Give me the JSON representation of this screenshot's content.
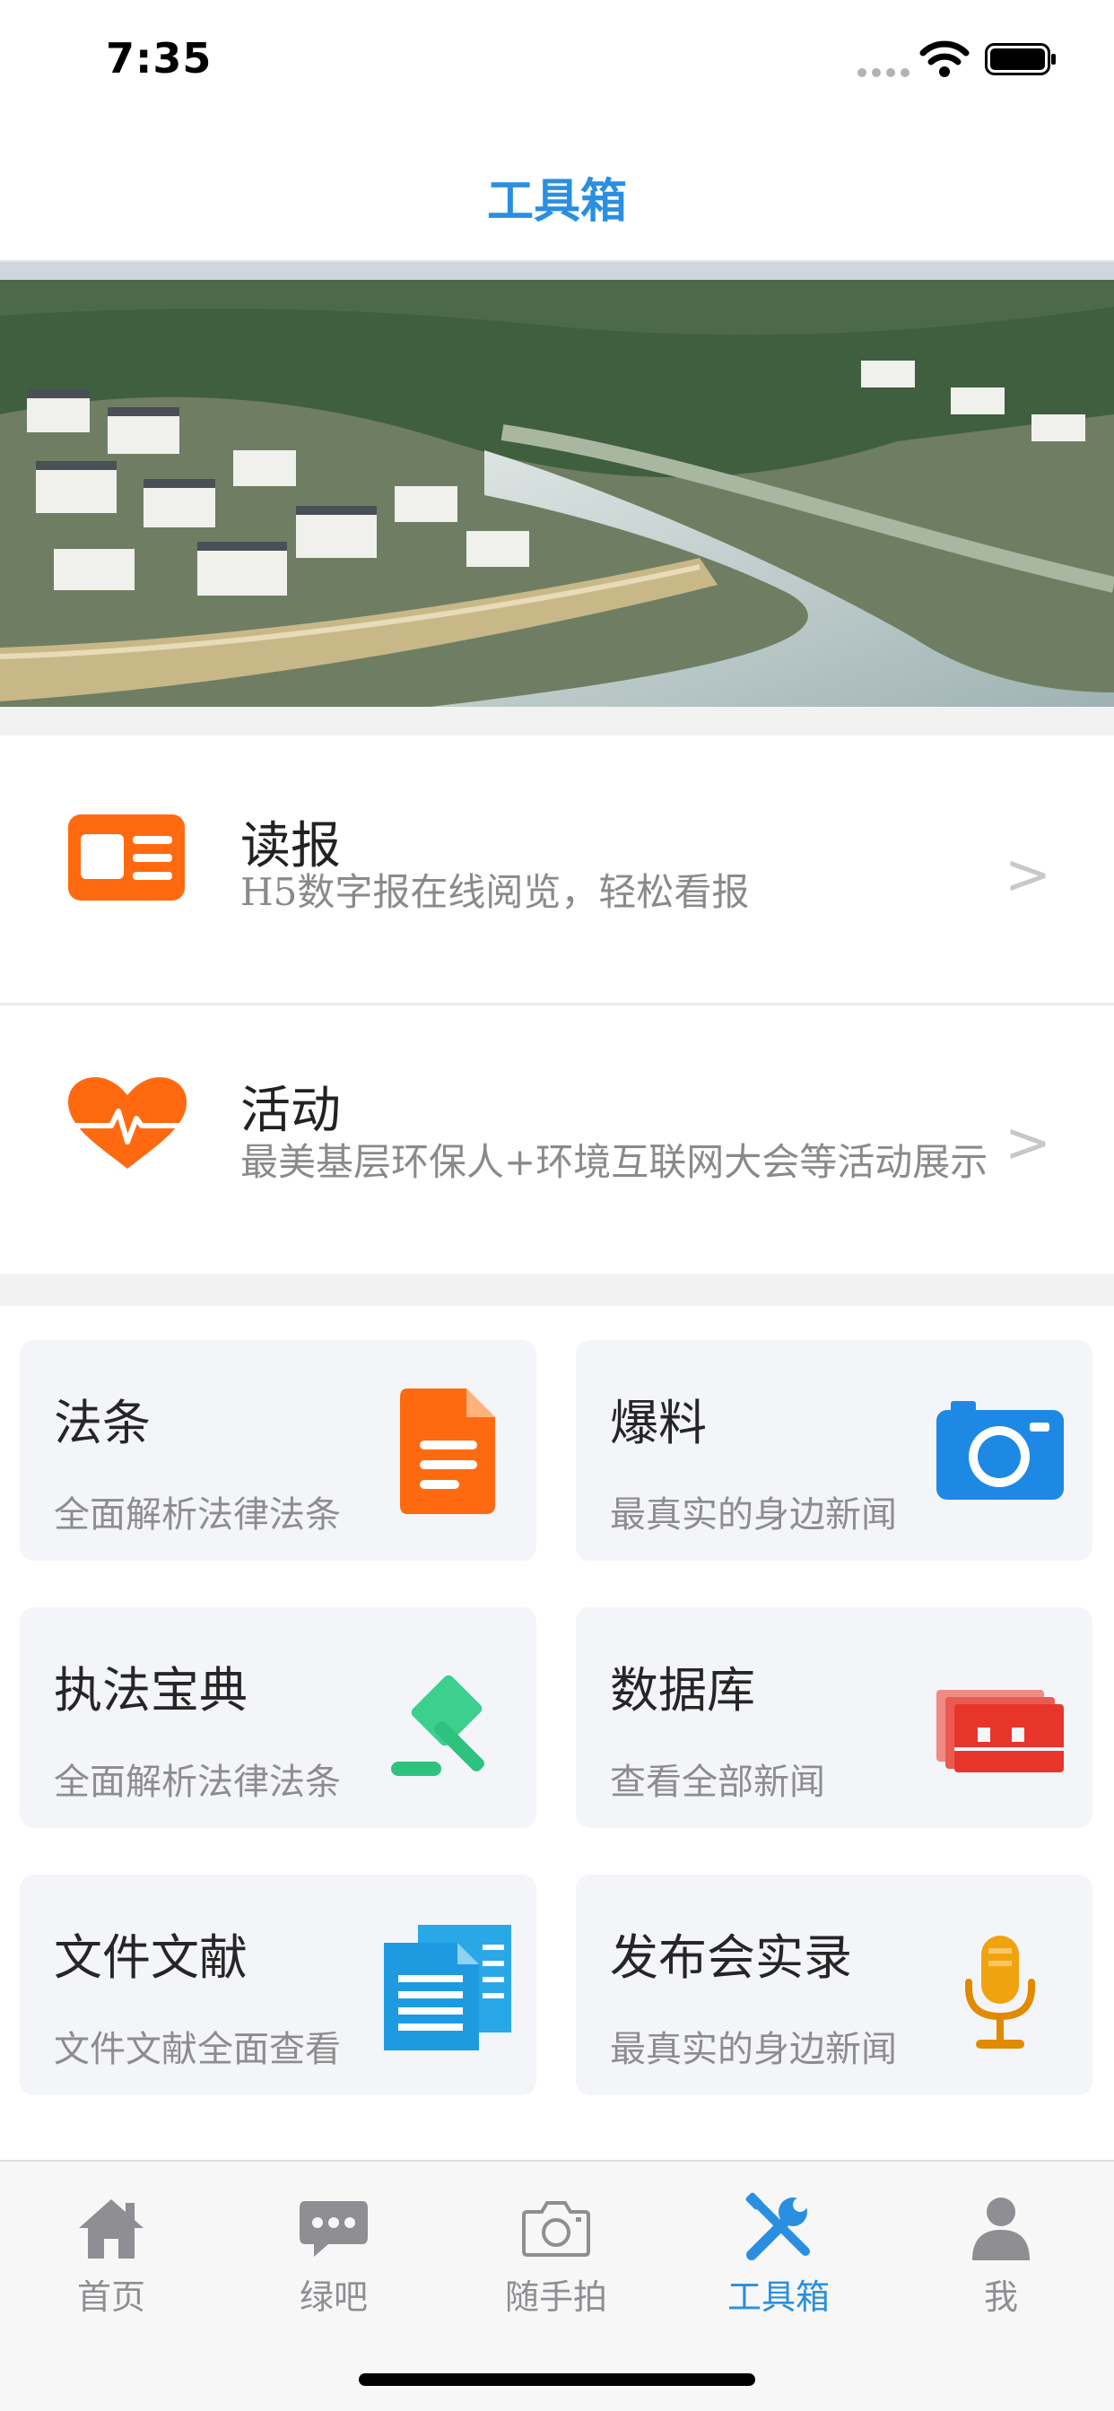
{
  "status": {
    "time": "7:35"
  },
  "nav": {
    "title": "工具箱"
  },
  "banner": {
    "slides": 4,
    "active_slide": 1
  },
  "list": [
    {
      "title": "读报",
      "subtitle": "H5数字报在线阅览，轻松看报",
      "arrow": ">",
      "icon": "newspaper-icon"
    },
    {
      "title": "活动",
      "subtitle": "最美基层环保人+环境互联网大会等活动展示",
      "arrow": ">",
      "icon": "heartbeat-icon"
    }
  ],
  "grid": [
    {
      "title": "法条",
      "subtitle": "全面解析法律法条",
      "icon": "document-icon"
    },
    {
      "title": "爆料",
      "subtitle": "最真实的身边新闻",
      "icon": "camera-icon"
    },
    {
      "title": "执法宝典",
      "subtitle": "全面解析法律法条",
      "icon": "gavel-icon"
    },
    {
      "title": "数据库",
      "subtitle": "查看全部新闻",
      "icon": "database-icon"
    },
    {
      "title": "文件文献",
      "subtitle": "文件文献全面查看",
      "icon": "files-icon"
    },
    {
      "title": "发布会实录",
      "subtitle": "最真实的身边新闻",
      "icon": "microphone-icon"
    }
  ],
  "tabs": [
    {
      "label": "首页",
      "icon": "home-icon"
    },
    {
      "label": "绿吧",
      "icon": "chat-icon"
    },
    {
      "label": "随手拍",
      "icon": "camera-icon"
    },
    {
      "label": "工具箱",
      "icon": "tools-icon"
    },
    {
      "label": "我",
      "icon": "user-icon"
    }
  ],
  "active_tab": "工具箱",
  "colors": {
    "accent": "#2a8fe0",
    "orange": "#ff6a10",
    "green": "#2fc27e",
    "red": "#e8352b",
    "gold": "#f1a20f"
  }
}
